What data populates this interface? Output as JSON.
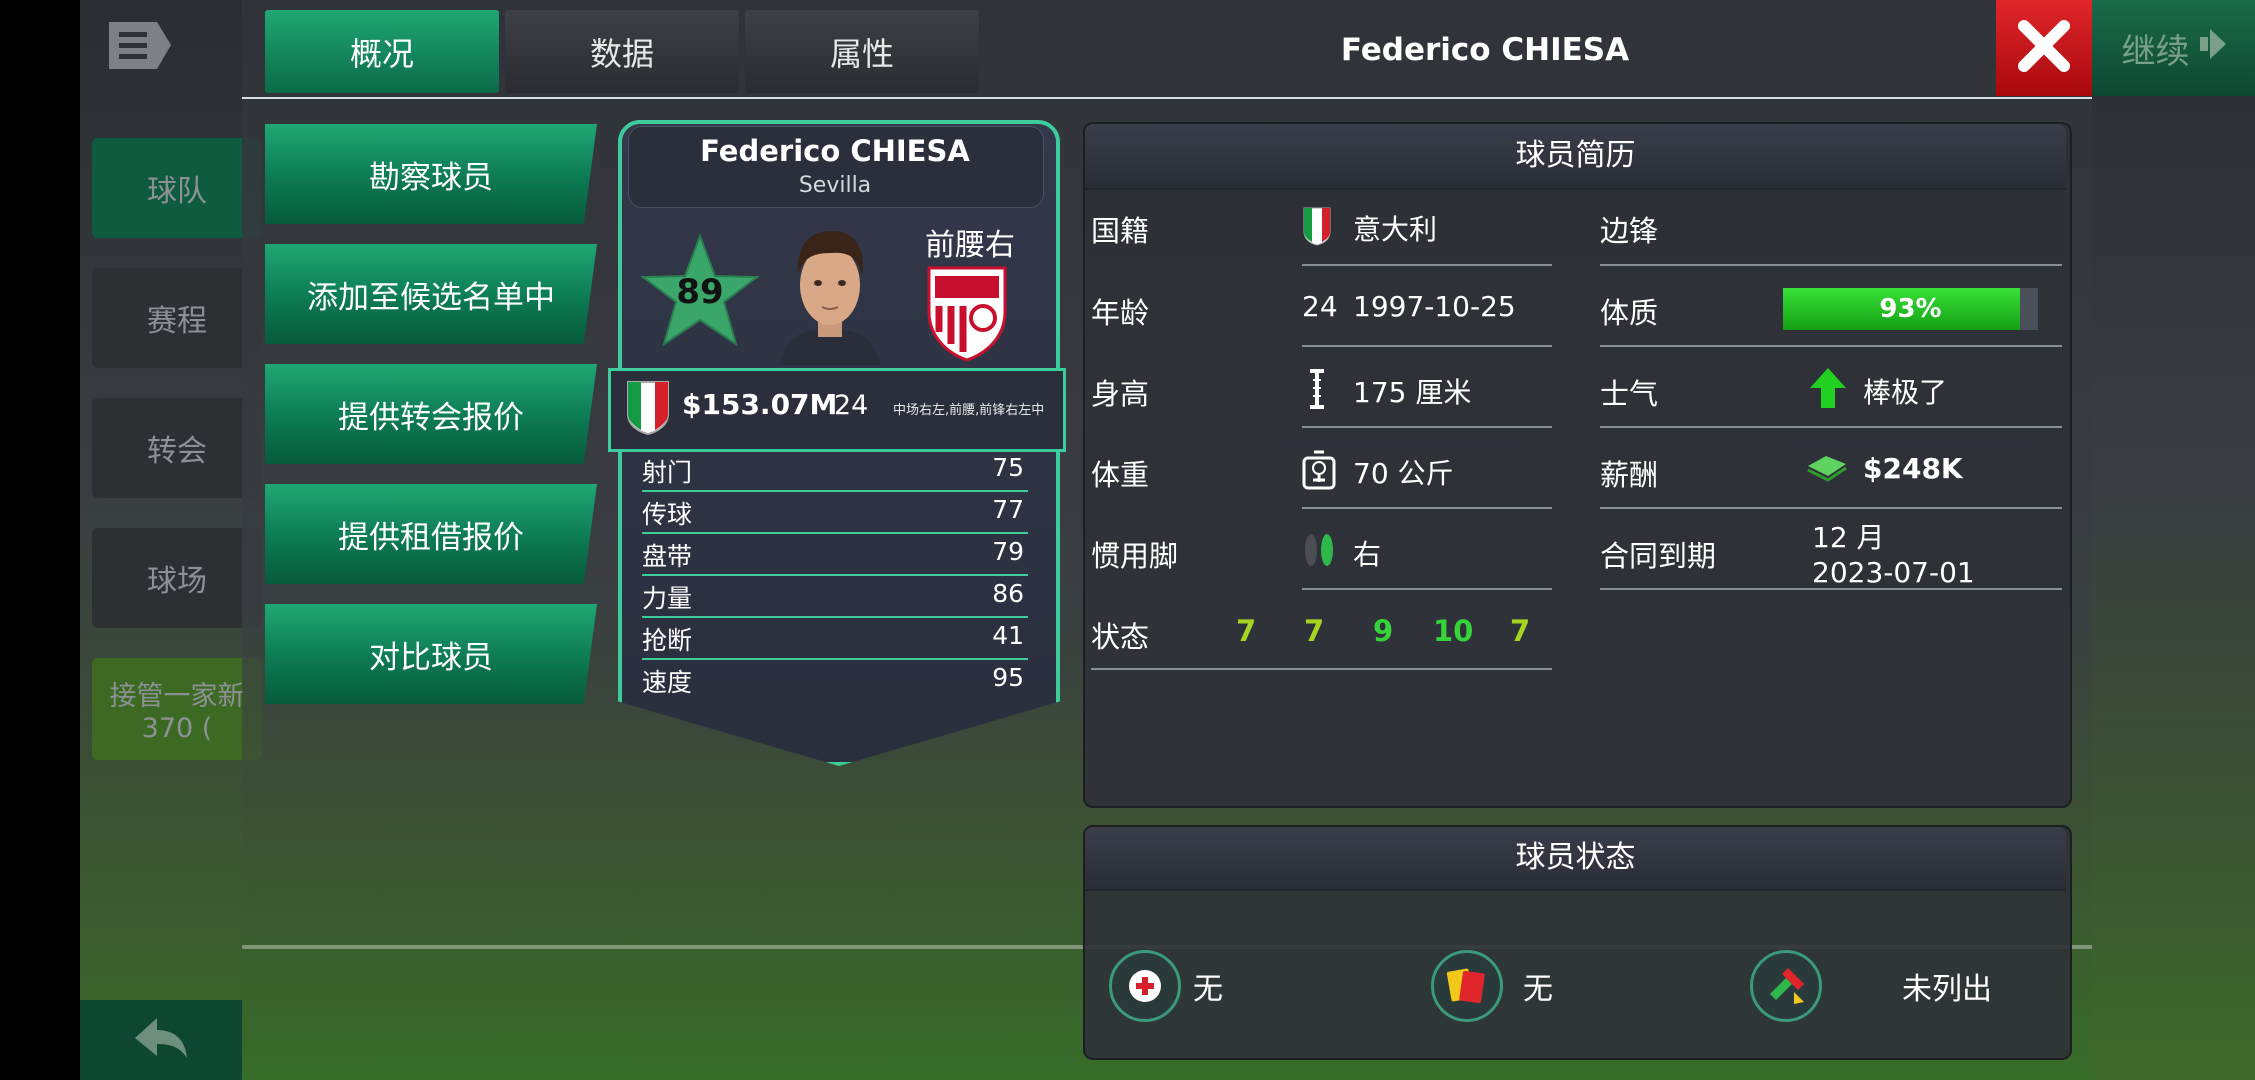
{
  "background": {
    "left_menu": [
      "球队",
      "赛程",
      "转会",
      "球场"
    ],
    "promo_line1": "接管一家新",
    "promo_line2": "370 ("
  },
  "header": {
    "tabs": [
      "概况",
      "数据",
      "属性"
    ],
    "title": "Federico CHIESA",
    "continue_label": "继续"
  },
  "actions": [
    "勘察球员",
    "添加至候选名单中",
    "提供转会报价",
    "提供租借报价",
    "对比球员"
  ],
  "player_card": {
    "name": "Federico CHIESA",
    "club": "Sevilla",
    "rating": "89",
    "position": "前腰右",
    "value": "$153.07M",
    "age": "24",
    "positions_detail": "中场右左,前腰,前锋右左中",
    "stats": [
      {
        "name": "射门",
        "value": "75"
      },
      {
        "name": "传球",
        "value": "77"
      },
      {
        "name": "盘带",
        "value": "79"
      },
      {
        "name": "力量",
        "value": "86"
      },
      {
        "name": "抢断",
        "value": "41"
      },
      {
        "name": "速度",
        "value": "95"
      }
    ]
  },
  "bio": {
    "title": "球员简历",
    "nationality_label": "国籍",
    "nationality": "意大利",
    "age_label": "年龄",
    "age": "24",
    "birthdate": "1997-10-25",
    "height_label": "身高",
    "height": "175 厘米",
    "weight_label": "体重",
    "weight": "70 公斤",
    "foot_label": "惯用脚",
    "foot": "右",
    "form_label": "状态",
    "form": [
      "7",
      "7",
      "9",
      "10",
      "7"
    ],
    "role": "边锋",
    "fitness_label": "体质",
    "fitness": "93%",
    "fitness_fraction": 0.93,
    "morale_label": "士气",
    "morale": "棒极了",
    "wage_label": "薪酬",
    "wage": "$248K",
    "contract_label": "合同到期",
    "contract_months": "12 月",
    "contract_date": "2023-07-01"
  },
  "status": {
    "title": "球员状态",
    "injury": "无",
    "cards": "无",
    "listing": "未列出"
  },
  "colors": {
    "accent_green": "#1fa774",
    "card_border": "#3fcc9c",
    "close_red": "#d8161c",
    "form_high": "#35d43a",
    "form_mid": "#a6d422"
  }
}
